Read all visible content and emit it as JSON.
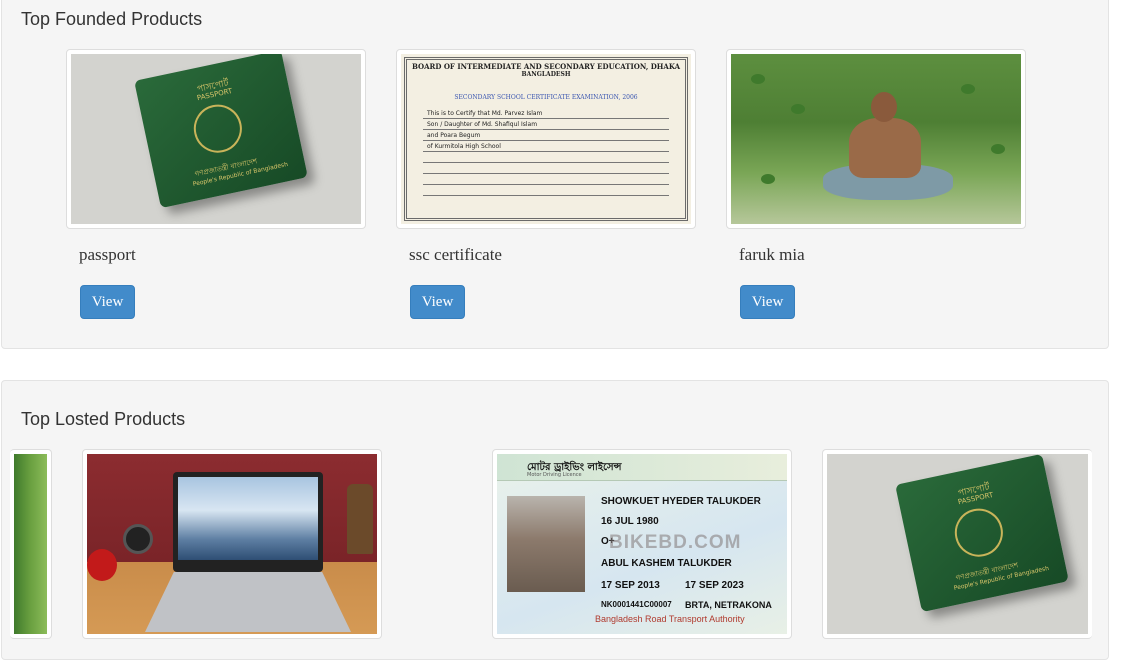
{
  "found_section": {
    "title": "Top Founded Products",
    "items": [
      {
        "name": "passport",
        "button": "View",
        "image": "passport-photo"
      },
      {
        "name": "ssc certificate",
        "button": "View",
        "image": "certificate-photo"
      },
      {
        "name": "faruk mia",
        "button": "View",
        "image": "person-photo"
      }
    ]
  },
  "lost_section": {
    "title": "Top Losted Products",
    "items": [
      {
        "image": "grass-photo"
      },
      {
        "image": "laptop-photo"
      },
      {
        "image": "driving-license-photo"
      },
      {
        "image": "passport-photo"
      }
    ]
  },
  "passport_text": {
    "top": "পাসপোর্ট",
    "label": "PASSPORT",
    "country_bn": "গণপ্রজাতন্ত্রী বাংলাদেশ",
    "country_en": "People's Republic of Bangladesh"
  },
  "certificate_text": {
    "board": "BOARD OF INTERMEDIATE AND SECONDARY EDUCATION, DHAKA",
    "country": "BANGLADESH",
    "exam": "SECONDARY SCHOOL CERTIFICATE EXAMINATION, 2006",
    "line1": "This is to Certify that   Md. Parvez Islam",
    "line2": "Son / Daughter of   Md. Shafiqul Islam",
    "line3": "and   Poara Begum",
    "line4": "of   Kurmitola High School"
  },
  "license_text": {
    "header": "মোটর ড্রাইভিং লাইসেন্স",
    "header_en": "Motor Driving Licence",
    "name": "SHOWKUET HYEDER TALUKDER",
    "dob": "16 JUL 1980",
    "blood": "O+",
    "father": "ABUL KASHEM TALUKDER",
    "issue": "17 SEP 2013",
    "validity": "17 SEP 2023",
    "licence_no": "NK0001441C00007",
    "authority": "BRTA, NETRAKONA",
    "watermark": "BIKEBD.COM",
    "footer": "Bangladesh Road Transport Authority"
  }
}
